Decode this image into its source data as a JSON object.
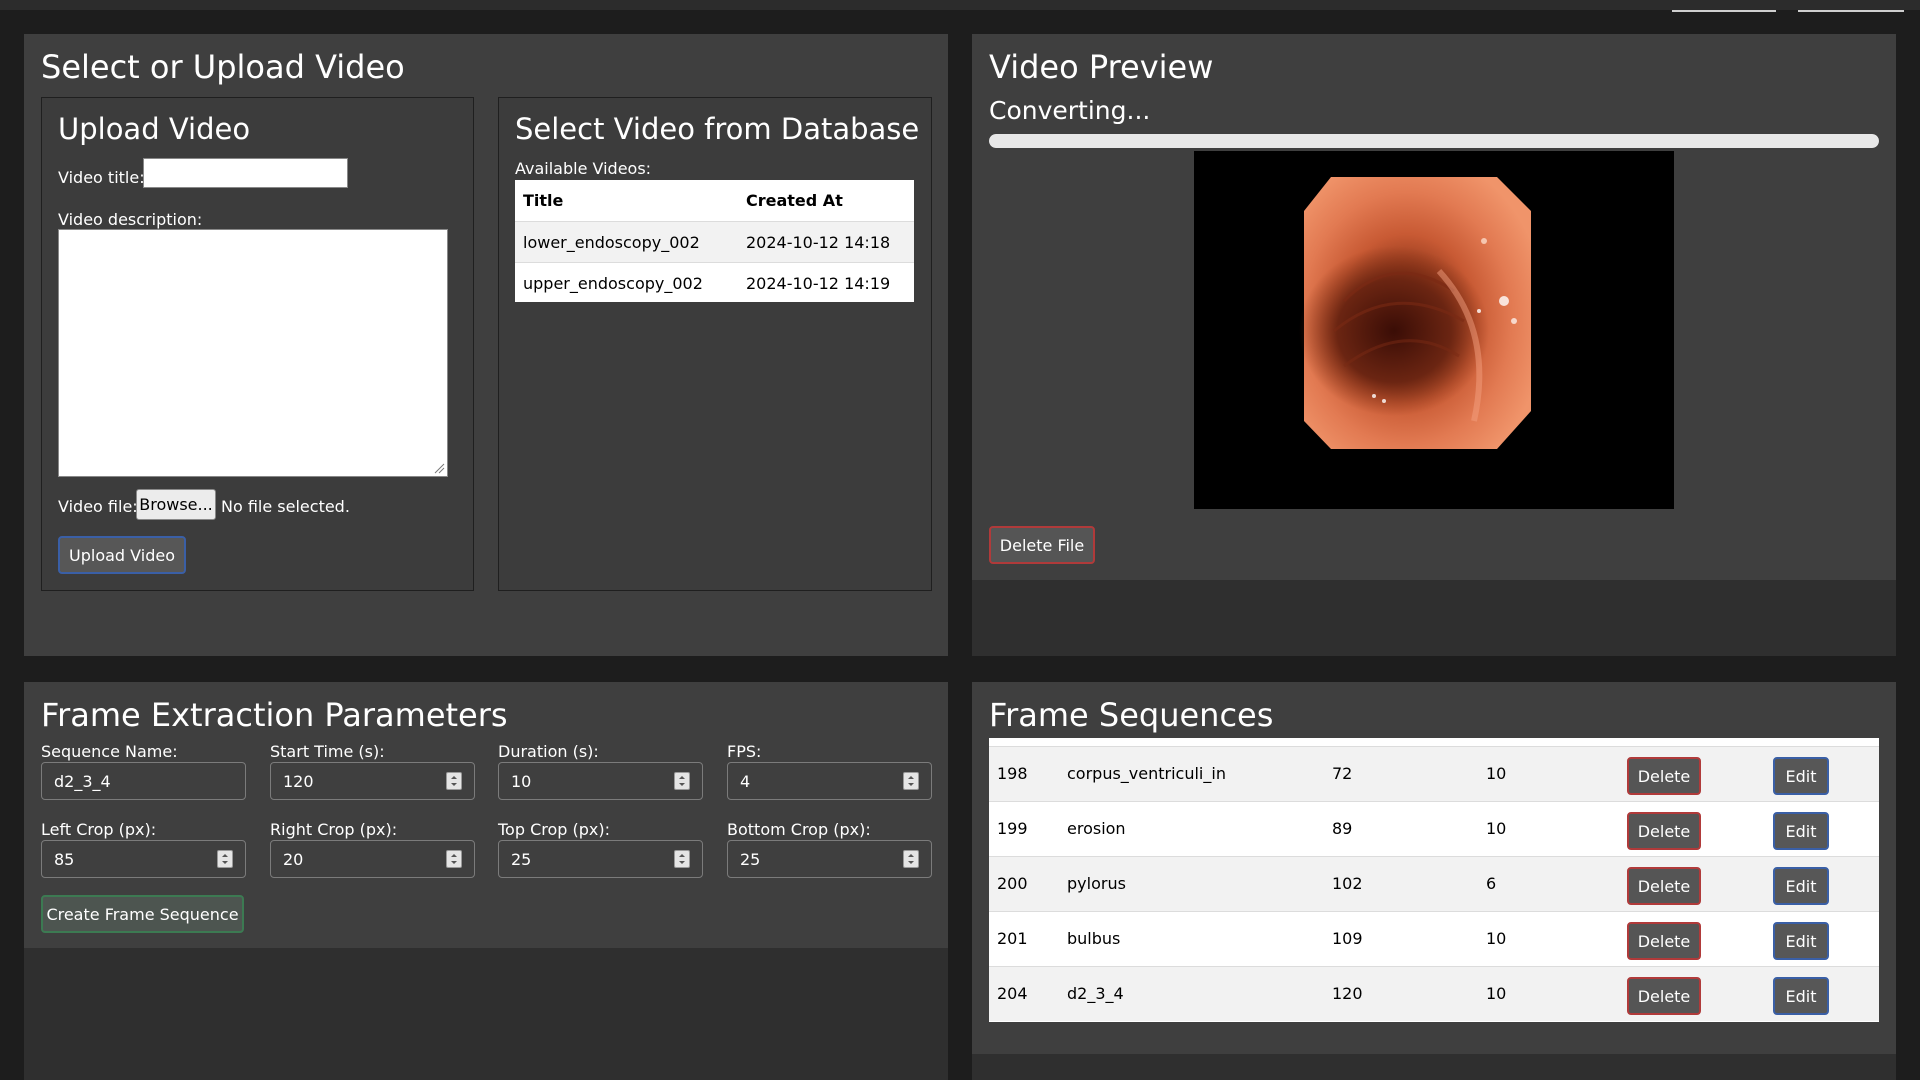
{
  "upload_panel": {
    "title": "Select or Upload Video",
    "upload_box": {
      "title": "Upload Video",
      "video_title_label": "Video title:",
      "video_title_value": "",
      "video_description_label": "Video description:",
      "video_file_label": "Video file:",
      "browse_label": "Browse...",
      "no_file_text": "No file selected.",
      "upload_button": "Upload Video"
    },
    "database_box": {
      "title": "Select Video from Database",
      "available_label": "Available Videos:",
      "columns": [
        "Title",
        "Created At"
      ],
      "rows": [
        {
          "title": "lower_endoscopy_002",
          "created_at": "2024-10-12 14:18"
        },
        {
          "title": "upper_endoscopy_002",
          "created_at": "2024-10-12 14:19"
        }
      ]
    }
  },
  "preview_panel": {
    "title": "Video Preview",
    "status_text": "Converting...",
    "progress_fraction": 1.0,
    "delete_file_button": "Delete File"
  },
  "extraction_panel": {
    "title": "Frame Extraction Parameters",
    "fields": {
      "sequence_name": {
        "label": "Sequence Name:",
        "value": "d2_3_4"
      },
      "start_time": {
        "label": "Start Time (s):",
        "value": "120"
      },
      "duration": {
        "label": "Duration (s):",
        "value": "10"
      },
      "fps": {
        "label": "FPS:",
        "value": "4"
      },
      "left_crop": {
        "label": "Left Crop (px):",
        "value": "85"
      },
      "right_crop": {
        "label": "Right Crop (px):",
        "value": "20"
      },
      "top_crop": {
        "label": "Top Crop (px):",
        "value": "25"
      },
      "bottom_crop": {
        "label": "Bottom Crop (px):",
        "value": "25"
      }
    },
    "create_button": "Create Frame Sequence"
  },
  "sequences_panel": {
    "title": "Frame Sequences",
    "delete_label": "Delete",
    "edit_label": "Edit",
    "rows": [
      {
        "id": "198",
        "name": "corpus_ventriculi_in",
        "start": "72",
        "duration": "10"
      },
      {
        "id": "199",
        "name": "erosion",
        "start": "89",
        "duration": "10"
      },
      {
        "id": "200",
        "name": "pylorus",
        "start": "102",
        "duration": "6"
      },
      {
        "id": "201",
        "name": "bulbus",
        "start": "109",
        "duration": "10"
      },
      {
        "id": "204",
        "name": "d2_3_4",
        "start": "120",
        "duration": "10"
      }
    ]
  },
  "colors": {
    "background": "#1d1d1d",
    "panel": "#3f3f3f",
    "danger_border": "#b03a3a",
    "primary_border": "#3a5fa6",
    "success_border": "#3c7a52"
  }
}
